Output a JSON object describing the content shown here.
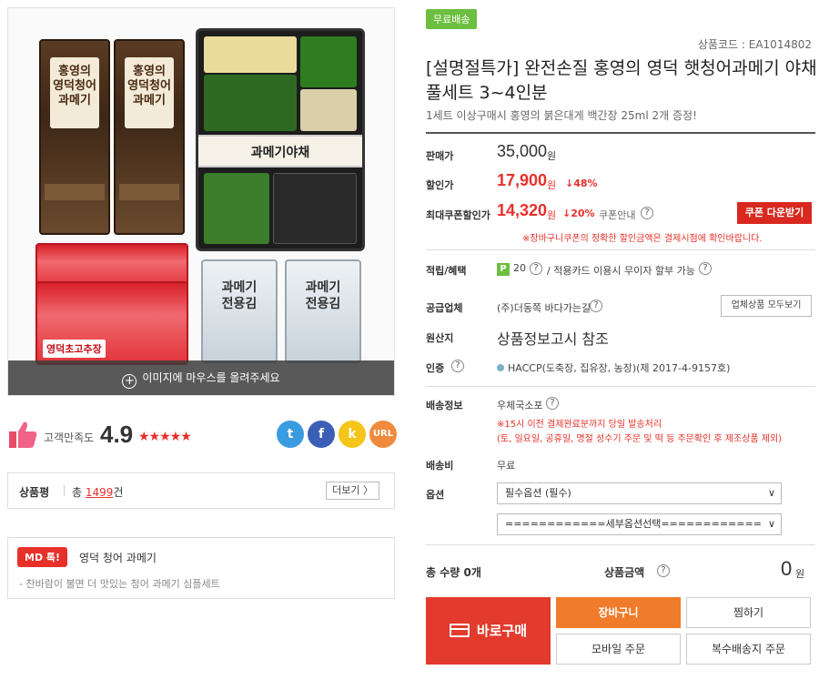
{
  "gallery": {
    "hover_hint": "이미지에 마우스를 올려주세요",
    "packages": {
      "fish1_label": "홍영의\n영덕청어\n과메기",
      "fish2_label": "홍영의\n영덕청어\n과메기",
      "tray_label": "과메기야채",
      "sauce_label": "영덕초고추장",
      "kim1_label": "과메기\n전용김",
      "kim2_label": "과메기\n전용김"
    }
  },
  "rating": {
    "label": "고객만족도",
    "score": "4.9",
    "stars": "★★★★★"
  },
  "share": {
    "twitter": "t",
    "facebook": "f",
    "kakao": "k",
    "url": "URL"
  },
  "review": {
    "title": "상품평",
    "count_prefix": "총",
    "count": "1499",
    "count_suffix": "건",
    "more": "더보기 〉"
  },
  "md": {
    "badge": "MD 톡!",
    "title": "영덕 청어 과메기",
    "desc": "- 찬바람이 불면 더 맛있는 청어 과메기 심플세트"
  },
  "product": {
    "free_shipping": "무료배송",
    "code": "상품코드 : EA1014802",
    "title": "[설명절특가] 완전손질 홍영의 영덕 햇청어과메기 야채풀세트 3~4인분",
    "subtitle": "1세트 이상구매시 홍영의 붉은대게 백간장 25ml 2개 증정!"
  },
  "pricing": {
    "sale_label": "판매가",
    "sale_price": "35,000",
    "discount_label": "할인가",
    "discount_price": "17,900",
    "discount_pct": "↓48%",
    "coupon_label": "최대쿠폰할인가",
    "coupon_price": "14,320",
    "coupon_pct": "↓20%",
    "coupon_info": "쿠폰안내",
    "coupon_button": "쿠폰 다운받기",
    "coupon_note": "※장바구니쿠폰의 정확한 할인금액은 결제시점에 확인바랍니다.",
    "won": "원"
  },
  "benefits": {
    "label": "적립/혜택",
    "point_icon": "P",
    "points": "20",
    "card_text": "/  적용카드 이용시 무이자 할부 가능"
  },
  "supplier": {
    "label": "공급업체",
    "name": "(주)더동쪽 바다가는길",
    "all_products": "업체상품 모두보기"
  },
  "origin": {
    "label": "원산지",
    "value": "상품정보고시 참조"
  },
  "certification": {
    "label": "인증",
    "value": "HACCP(도축장, 집유장, 농장)(제 2017-4-9157호)"
  },
  "shipping": {
    "label": "배송정보",
    "method": "우체국소포",
    "note1": "※15시 이전 결제완료분까지 당일 발송처리",
    "note2": "(토, 일요일, 공휴일, 명절 성수기 주문 및 떡 등 주문확인 후 제조상품 제외)",
    "fee_label": "배송비",
    "fee_value": "무료"
  },
  "options": {
    "label": "옵션",
    "required": "필수옵션 (필수)",
    "sub": "============세부옵션선택============"
  },
  "totals": {
    "quantity_label": "총 수량 0개",
    "amount_label": "상품금액",
    "amount": "0",
    "won": "원"
  },
  "actions": {
    "buy_now": "바로구매",
    "cart": "장바구니",
    "wishlist": "찜하기",
    "mobile_order": "모바일 주문",
    "multi_address": "복수배송지 주문"
  },
  "colors": {
    "accent_red": "#e7302a",
    "cart_orange": "#f07b2a",
    "free_ship_green": "#6cbf3f"
  }
}
